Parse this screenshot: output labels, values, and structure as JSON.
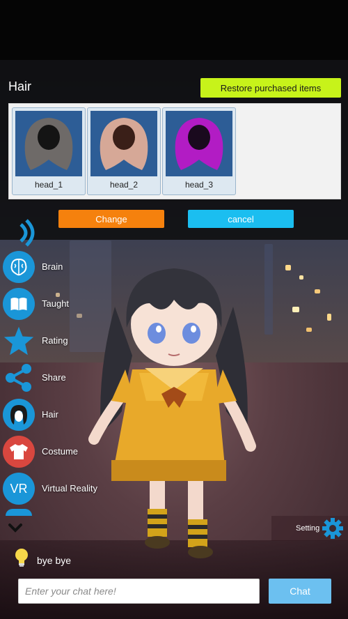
{
  "hair_panel": {
    "title": "Hair",
    "restore_label": "Restore purchased items",
    "items": [
      {
        "label": "head_1",
        "hair_color": "#6e6a68"
      },
      {
        "label": "head_2",
        "hair_color": "#d6a897"
      },
      {
        "label": "head_3",
        "hair_color": "#b21cc4"
      }
    ],
    "change_label": "Change",
    "cancel_label": "cancel"
  },
  "side_menu": {
    "items": [
      {
        "label": "Brain",
        "icon": "brain-icon"
      },
      {
        "label": "Taught",
        "icon": "book-icon"
      },
      {
        "label": "Rating",
        "icon": "star-icon"
      },
      {
        "label": "Share",
        "icon": "share-icon"
      },
      {
        "label": "Hair",
        "icon": "hair-icon"
      },
      {
        "label": "Costume",
        "icon": "shirt-icon"
      },
      {
        "label": "Virtual Reality",
        "icon": "vr-icon",
        "icon_text": "VR"
      }
    ]
  },
  "settings": {
    "label": "Setting"
  },
  "chat": {
    "last_message": "bye bye",
    "input_placeholder": "Enter your chat here!",
    "send_label": "Chat"
  },
  "colors": {
    "restore": "#c7f31a",
    "change": "#f5810d",
    "cancel": "#1bbef0",
    "menu_blue": "#1a96d8",
    "costume_red": "#d9473f",
    "chat_button": "#6cc0f0"
  }
}
